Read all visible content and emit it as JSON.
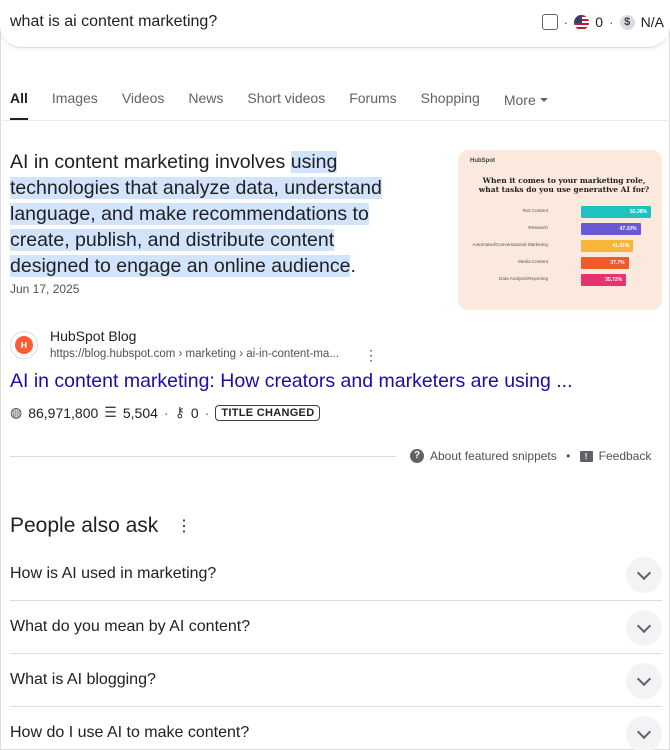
{
  "search": {
    "query": "what is ai content marketing?",
    "flag_count": "0",
    "price": "N/A"
  },
  "tabs": [
    {
      "label": "All",
      "active": true
    },
    {
      "label": "Images"
    },
    {
      "label": "Videos"
    },
    {
      "label": "News"
    },
    {
      "label": "Short videos"
    },
    {
      "label": "Forums"
    },
    {
      "label": "Shopping"
    },
    {
      "label": "More"
    }
  ],
  "snippet": {
    "text_plain": "AI in content marketing involves ",
    "text_highlight_1": "using",
    "text_highlight_2": "technologies that analyze data, understand",
    "text_highlight_3": "language, and make recommendations to",
    "text_highlight_4": "create, publish, and distribute content",
    "text_highlight_5": "designed to engage an online audience",
    "text_end": ".",
    "date": "Jun 17, 2025"
  },
  "thumbnail": {
    "logo": "HubSpot",
    "title": "When it comes to your marketing role, what tasks do you use generative AI for?",
    "bars": [
      {
        "label": "Text Content",
        "value": "55.38%",
        "pct": 55.38,
        "color": "#1ec2c1"
      },
      {
        "label": "Research",
        "value": "47.10%",
        "pct": 47.1,
        "color": "#6a5ad6"
      },
      {
        "label": "Automated/Conversational Marketing",
        "value": "41.41%",
        "pct": 41.41,
        "color": "#f7b53b"
      },
      {
        "label": "Media Content",
        "value": "37.7%",
        "pct": 37.7,
        "color": "#ef5b2a"
      },
      {
        "label": "Data Analysis/Reporting",
        "value": "35.72%",
        "pct": 35.72,
        "color": "#e8346e"
      }
    ]
  },
  "source": {
    "name": "HubSpot Blog",
    "url": "https://blog.hubspot.com › marketing › ai-in-content-ma...",
    "title": "AI in content marketing: How creators and marketers are using ...",
    "views": "86,971,800",
    "words": "5,504",
    "keys": "0",
    "badge": "TITLE CHANGED"
  },
  "snippet_footer": {
    "about": "About featured snippets",
    "feedback": "Feedback"
  },
  "paa": {
    "title": "People also ask",
    "questions": [
      "How is AI used in marketing?",
      "What do you mean by AI content?",
      "What is AI blogging?",
      "How do I use AI to make content?"
    ]
  }
}
